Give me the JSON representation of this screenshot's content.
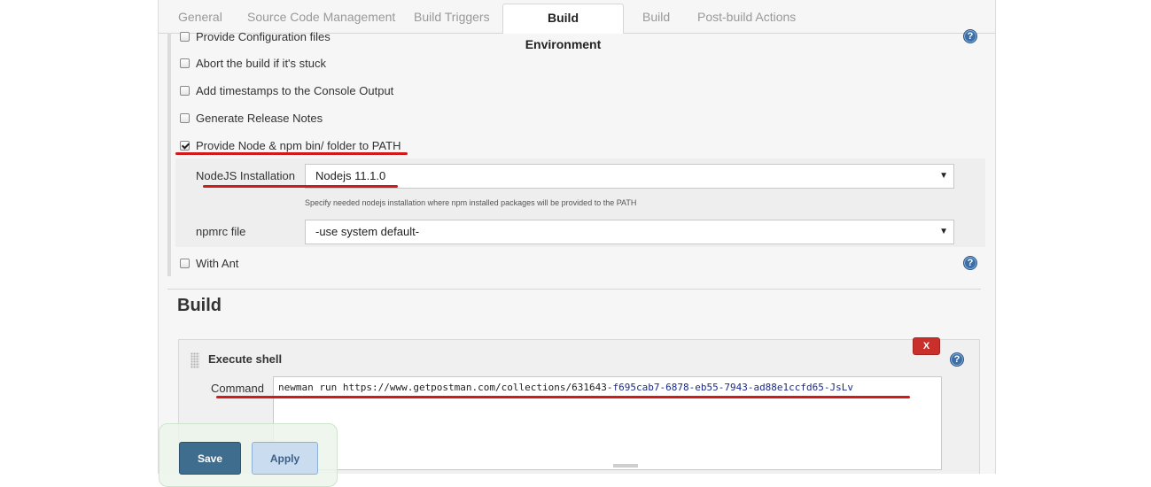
{
  "tabs": [
    {
      "label": "General"
    },
    {
      "label": "Source Code Management"
    },
    {
      "label": "Build Triggers"
    },
    {
      "label": "Build Environment",
      "active": true
    },
    {
      "label": "Build"
    },
    {
      "label": "Post-build Actions"
    }
  ],
  "build_environment": {
    "options": [
      {
        "label": "Provide Configuration files",
        "checked": false
      },
      {
        "label": "Abort the build if it's stuck",
        "checked": false
      },
      {
        "label": "Add timestamps to the Console Output",
        "checked": false
      },
      {
        "label": "Generate Release Notes",
        "checked": false
      },
      {
        "label": "Provide Node & npm bin/ folder to PATH",
        "checked": true
      },
      {
        "label": "With Ant",
        "checked": false
      }
    ],
    "nodejs": {
      "label": "NodeJS Installation",
      "value": "Nodejs 11.1.0",
      "hint": "Specify needed nodejs installation where npm installed packages will be provided to the PATH"
    },
    "npmrc": {
      "label": "npmrc file",
      "value": "-use system default-"
    }
  },
  "build": {
    "title": "Build",
    "step": {
      "title": "Execute shell",
      "delete_label": "X",
      "command_label": "Command",
      "command_prefix": "newman run https://www.getpostman.com/collections/631643-",
      "command_suffix": "f695cab7-6878-eb55-7943-ad88e1ccfd65-JsLv"
    }
  },
  "buttons": {
    "save": "Save",
    "apply": "Apply"
  },
  "help_icon": "?",
  "colors": {
    "annotation_red": "#d11a1a",
    "save_blue": "#3e6d8e",
    "apply_blue": "#c9dcf0",
    "delete_red": "#c9302c",
    "help_blue": "#3c6fa8"
  }
}
